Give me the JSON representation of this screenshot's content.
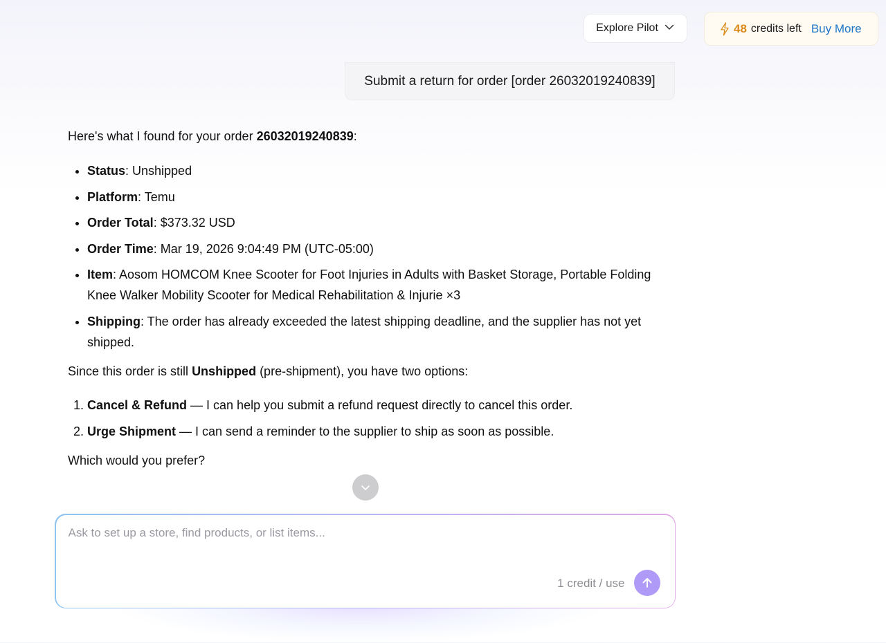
{
  "topbar": {
    "explore_label": "Explore Pilot",
    "credits_count": "48",
    "credits_label": "credits left",
    "buy_more_label": "Buy More"
  },
  "user_message": "Submit a return for order [order 26032019240839]",
  "assistant": {
    "intro_prefix": "Here's what I found for your order ",
    "intro_order_id": "26032019240839",
    "intro_suffix": ":",
    "details": [
      {
        "label": "Status",
        "value": ": Unshipped"
      },
      {
        "label": "Platform",
        "value": ": Temu"
      },
      {
        "label": "Order Total",
        "value": ": $373.32 USD"
      },
      {
        "label": "Order Time",
        "value": ": Mar 19, 2026 9:04:49 PM (UTC-05:00)"
      },
      {
        "label": "Item",
        "value": ": Aosom HOMCOM Knee Scooter for Foot Injuries in Adults with Basket Storage, Portable Folding Knee Walker Mobility Scooter for Medical Rehabilitation & Injurie ×3"
      },
      {
        "label": "Shipping",
        "value": ": The order has already exceeded the latest shipping deadline, and the supplier has not yet shipped."
      }
    ],
    "since_prefix": "Since this order is still ",
    "since_bold": "Unshipped",
    "since_suffix": " (pre-shipment), you have two options:",
    "options": [
      {
        "label": "Cancel & Refund",
        "value": " — I can help you submit a refund request directly to cancel this order."
      },
      {
        "label": "Urge Shipment",
        "value": " — I can send a reminder to the supplier to ship as soon as possible."
      }
    ],
    "question": "Which would you prefer?"
  },
  "composer": {
    "placeholder": "Ask to set up a store, find products, or list items...",
    "value": "",
    "credit_cost": "1 credit / use"
  },
  "colors": {
    "credits_accent": "#d98a1a",
    "link": "#1e76c8",
    "send_button": "#b09af7"
  },
  "icons": {
    "explore_chevron": "chevron-down-icon",
    "credits": "lightning-bolt-icon",
    "scroll": "chevron-down-icon",
    "send": "arrow-up-icon"
  }
}
